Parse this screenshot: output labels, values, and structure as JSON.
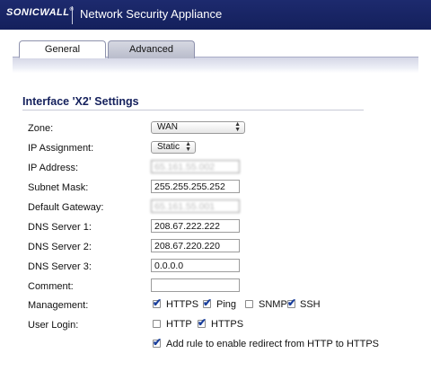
{
  "header": {
    "logo_text": "SONICWALL",
    "logo_reg": "®",
    "app_title": "Network Security Appliance"
  },
  "tabs": {
    "general": "General",
    "advanced": "Advanced"
  },
  "section": {
    "title": "Interface 'X2' Settings"
  },
  "form": {
    "zone_label": "Zone:",
    "zone_value": "WAN",
    "ip_assignment_label": "IP Assignment:",
    "ip_assignment_value": "Static",
    "ip_address_label": "IP Address:",
    "ip_address_value": "65.161.55.002",
    "subnet_mask_label": "Subnet Mask:",
    "subnet_mask_value": "255.255.255.252",
    "default_gateway_label": "Default Gateway:",
    "default_gateway_value": "65.161.55.001",
    "dns1_label": "DNS Server 1:",
    "dns1_value": "208.67.222.222",
    "dns2_label": "DNS Server 2:",
    "dns2_value": "208.67.220.220",
    "dns3_label": "DNS Server 3:",
    "dns3_value": "0.0.0.0",
    "comment_label": "Comment:",
    "comment_value": "",
    "management_label": "Management:",
    "management": {
      "https": {
        "label": "HTTPS",
        "checked": true
      },
      "ping": {
        "label": "Ping",
        "checked": true
      },
      "snmp": {
        "label": "SNMP",
        "checked": false
      },
      "ssh": {
        "label": "SSH",
        "checked": true
      }
    },
    "user_login_label": "User Login:",
    "user_login": {
      "http": {
        "label": "HTTP",
        "checked": false
      },
      "https": {
        "label": "HTTPS",
        "checked": true
      }
    },
    "redirect_label": "Add rule to enable redirect from HTTP to HTTPS",
    "redirect_checked": true
  },
  "colors": {
    "header_bg": "#1d2a6e",
    "section_title": "#14205c",
    "check_color": "#1a3f9c"
  }
}
